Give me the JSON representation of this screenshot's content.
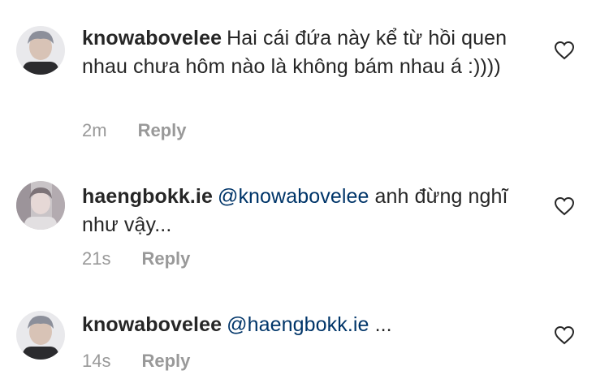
{
  "comments": [
    {
      "username": "knowabovelee",
      "mention": "",
      "text": "Hai cái đứa này kể từ hồi quen nhau chưa hôm nào là không bám nhau á :))))",
      "time": "2m",
      "reply_label": "Reply"
    },
    {
      "username": "haengbokk.ie",
      "mention": "@knowabovelee",
      "text": " anh đừng nghĩ như vậy...",
      "time": "21s",
      "reply_label": "Reply"
    },
    {
      "username": "knowabovelee",
      "mention": "@haengbokk.ie",
      "text": " ...",
      "time": "14s",
      "reply_label": "Reply"
    }
  ],
  "colors": {
    "text": "#262626",
    "mention": "#003569",
    "meta": "#999999"
  },
  "icons": {
    "like": "heart-outline-icon"
  }
}
